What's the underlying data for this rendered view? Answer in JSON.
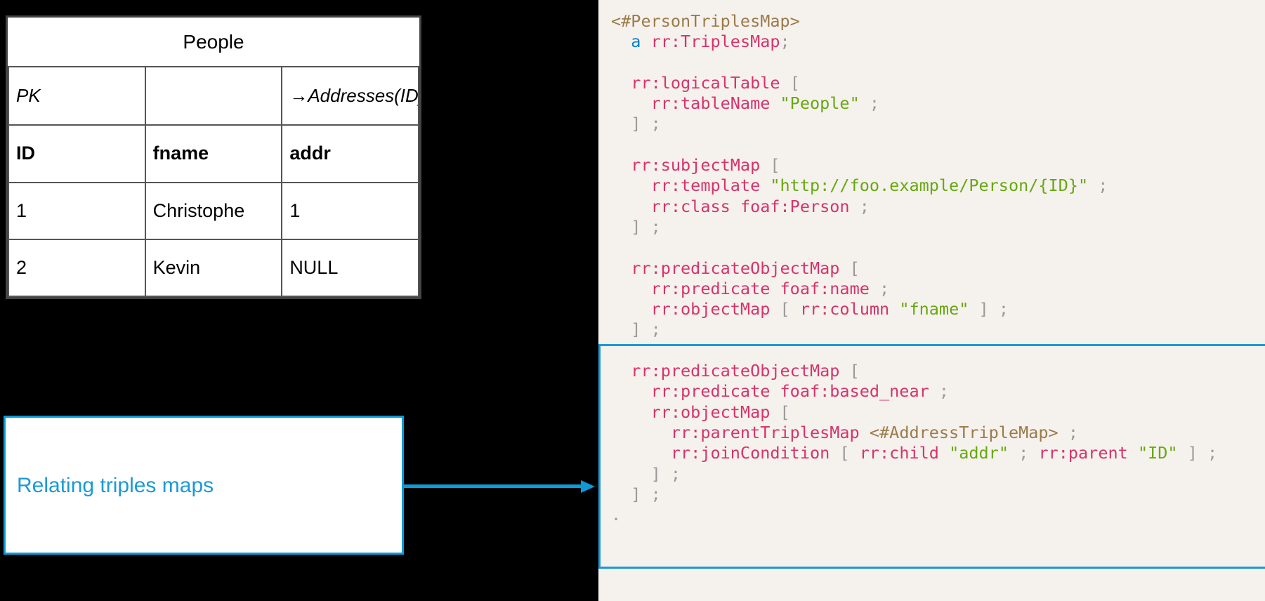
{
  "table": {
    "title": "People",
    "key_row": [
      "PK",
      "",
      "→Addresses(ID)"
    ],
    "headers": [
      "ID",
      "fname",
      "addr"
    ],
    "rows": [
      [
        "1",
        "Christophe",
        "1"
      ],
      [
        "2",
        "Kevin",
        "NULL"
      ]
    ]
  },
  "callout": {
    "label": "Relating triples maps",
    "border_color": "#0c9bd7",
    "text_color": "#1b9ad6"
  },
  "connector": {
    "icon": "arrow-right-icon",
    "color": "#0c9bd7"
  },
  "highlight": {
    "color": "#1b9ad6"
  },
  "code": {
    "language": "turtle",
    "background": "#f5f1ed",
    "colors": {
      "iri": "#9b7b4a",
      "keyword": "#d6336c",
      "type_a": "#0b7fc4",
      "string": "#66a80f",
      "punctuation": "#9a9a9a"
    },
    "lines": [
      "<#PersonTriplesMap>",
      "  a rr:TriplesMap;",
      "",
      "  rr:logicalTable [",
      "    rr:tableName \"People\" ;",
      "  ] ;",
      "",
      "  rr:subjectMap [",
      "    rr:template \"http://foo.example/Person/{ID}\" ;",
      "    rr:class foaf:Person ;",
      "  ] ;",
      "",
      "  rr:predicateObjectMap [",
      "    rr:predicate foaf:name ;",
      "    rr:objectMap [ rr:column \"fname\" ] ;",
      "  ] ;",
      "",
      "  rr:predicateObjectMap [",
      "    rr:predicate foaf:based_near ;",
      "    rr:objectMap [",
      "      rr:parentTriplesMap <#AddressTripleMap> ;",
      "      rr:joinCondition [ rr:child \"addr\" ; rr:parent \"ID\" ] ;",
      "    ] ;",
      "  ] ;",
      "."
    ]
  }
}
